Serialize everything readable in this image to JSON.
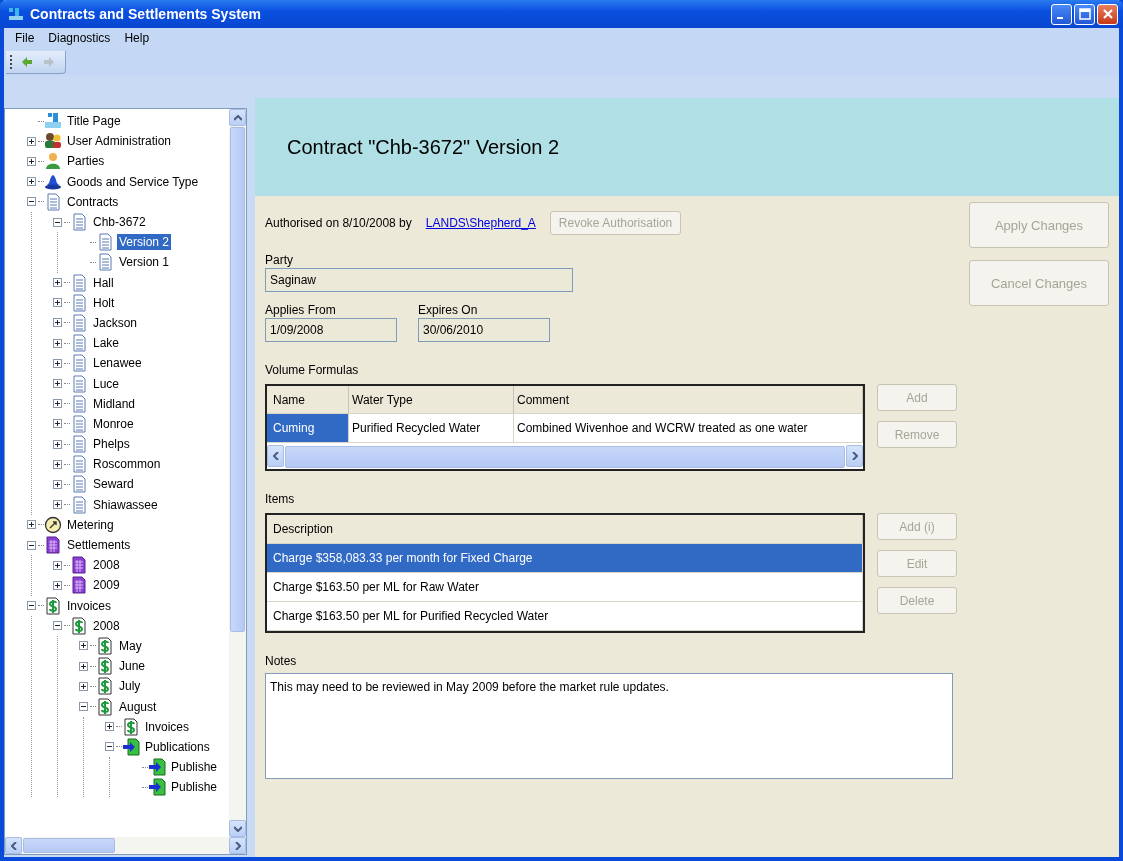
{
  "window": {
    "title": "Contracts and Settlements System"
  },
  "menu": [
    "File",
    "Diagnostics",
    "Help"
  ],
  "toolbar": [
    {
      "kind": "back",
      "disabled": false
    },
    {
      "kind": "forward",
      "disabled": true
    }
  ],
  "tree": [
    {
      "label": "Title Page",
      "kind": "title",
      "selected": false
    },
    {
      "label": "User Administration",
      "kind": "users",
      "expanded": false,
      "selected": false
    },
    {
      "label": "Parties",
      "kind": "person",
      "expanded": false,
      "selected": false
    },
    {
      "label": "Goods and Service Type",
      "kind": "goods",
      "expanded": false,
      "selected": false
    },
    {
      "label": "Contracts",
      "kind": "document",
      "expanded": true,
      "selected": false,
      "children": [
        {
          "label": "Chb-3672",
          "kind": "document",
          "expanded": true,
          "selected": false,
          "children": [
            {
              "label": "Version 2",
              "kind": "document",
              "selected": true
            },
            {
              "label": "Version 1",
              "kind": "document",
              "selected": false
            }
          ]
        },
        {
          "label": "Hall",
          "kind": "document",
          "expanded": false,
          "selected": false
        },
        {
          "label": "Holt",
          "kind": "document",
          "expanded": false,
          "selected": false
        },
        {
          "label": "Jackson",
          "kind": "document",
          "expanded": false,
          "selected": false
        },
        {
          "label": "Lake",
          "kind": "document",
          "expanded": false,
          "selected": false
        },
        {
          "label": "Lenawee",
          "kind": "document",
          "expanded": false,
          "selected": false
        },
        {
          "label": "Luce",
          "kind": "document",
          "expanded": false,
          "selected": false
        },
        {
          "label": "Midland",
          "kind": "document",
          "expanded": false,
          "selected": false
        },
        {
          "label": "Monroe",
          "kind": "document",
          "expanded": false,
          "selected": false
        },
        {
          "label": "Phelps",
          "kind": "document",
          "expanded": false,
          "selected": false
        },
        {
          "label": "Roscommon",
          "kind": "document",
          "expanded": false,
          "selected": false
        },
        {
          "label": "Seward",
          "kind": "document",
          "expanded": false,
          "selected": false
        },
        {
          "label": "Shiawassee",
          "kind": "document",
          "expanded": false,
          "selected": false
        }
      ]
    },
    {
      "label": "Metering",
      "kind": "meter",
      "expanded": false,
      "selected": false
    },
    {
      "label": "Settlements",
      "kind": "calendar",
      "expanded": true,
      "selected": false,
      "children": [
        {
          "label": "2008",
          "kind": "calendar",
          "expanded": false,
          "selected": false
        },
        {
          "label": "2009",
          "kind": "calendar",
          "expanded": false,
          "selected": false
        }
      ]
    },
    {
      "label": "Invoices",
      "kind": "dollar",
      "expanded": true,
      "selected": false,
      "children": [
        {
          "label": "2008",
          "kind": "dollar",
          "expanded": true,
          "selected": false,
          "children": [
            {
              "label": "May",
              "kind": "dollar",
              "expanded": false,
              "selected": false
            },
            {
              "label": "June",
              "kind": "dollar",
              "expanded": false,
              "selected": false
            },
            {
              "label": "July",
              "kind": "dollar",
              "expanded": false,
              "selected": false
            },
            {
              "label": "August",
              "kind": "dollar",
              "expanded": true,
              "selected": false,
              "children": [
                {
                  "label": "Invoices",
                  "kind": "dollar",
                  "expanded": false,
                  "selected": false
                },
                {
                  "label": "Publications",
                  "kind": "publish",
                  "expanded": true,
                  "selected": false,
                  "children": [
                    {
                      "label": "Publishe",
                      "kind": "publish",
                      "selected": false
                    },
                    {
                      "label": "Publishe",
                      "kind": "publish",
                      "selected": false
                    }
                  ]
                }
              ]
            }
          ]
        }
      ]
    }
  ],
  "contract": {
    "title": "Contract \"Chb-3672\" Version 2",
    "authorised_text": "Authorised on 8/10/2008 by",
    "authorised_by": "LANDS\\Shepherd_A",
    "revoke_button": {
      "label": "Revoke Authorisation",
      "disabled": true
    },
    "party": {
      "label": "Party",
      "value": "Saginaw"
    },
    "applies_from": {
      "label": "Applies From",
      "value": "1/09/2008"
    },
    "expires_on": {
      "label": "Expires On",
      "value": "30/06/2010"
    },
    "volume_formulas": {
      "label": "Volume Formulas",
      "columns": [
        "Name",
        "Water Type",
        "Comment"
      ],
      "rows": [
        {
          "cells": [
            "Cuming",
            "Purified Recycled Water",
            "Combined Wivenhoe and WCRW treated as one water"
          ],
          "selected": true
        }
      ],
      "buttons": [
        {
          "label": "Add",
          "disabled": true
        },
        {
          "label": "Remove",
          "disabled": true
        }
      ]
    },
    "items": {
      "label": "Items",
      "columns": [
        "Description"
      ],
      "rows": [
        {
          "cells": [
            "Charge $358,083.33 per month for Fixed Charge"
          ],
          "selected": true
        },
        {
          "cells": [
            "Charge $163.50 per ML for Raw Water"
          ],
          "selected": false
        },
        {
          "cells": [
            "Charge $163.50 per ML for Purified Recycled Water"
          ],
          "selected": false
        }
      ],
      "buttons": [
        {
          "label": "Add (i)",
          "disabled": true
        },
        {
          "label": "Edit",
          "disabled": true
        },
        {
          "label": "Delete",
          "disabled": true
        }
      ]
    },
    "notes": {
      "label": "Notes",
      "value": "This may need to be reviewed in May 2009 before the market rule updates."
    }
  },
  "actions": [
    {
      "label": "Apply Changes",
      "disabled": true
    },
    {
      "label": "Cancel Changes",
      "disabled": true
    }
  ]
}
